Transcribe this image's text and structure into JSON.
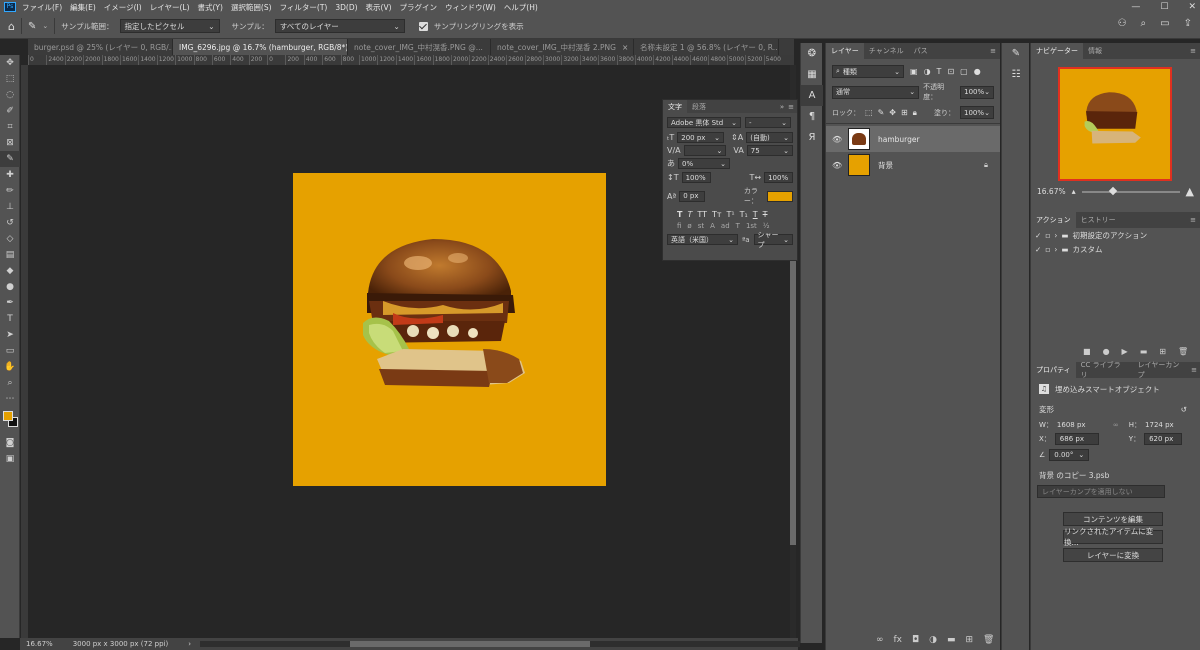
{
  "menu": [
    "ファイル(F)",
    "編集(E)",
    "イメージ(I)",
    "レイヤー(L)",
    "書式(Y)",
    "選択範囲(S)",
    "フィルター(T)",
    "3D(D)",
    "表示(V)",
    "プラグイン",
    "ウィンドウ(W)",
    "ヘルプ(H)"
  ],
  "app_logo": "Ps",
  "options": {
    "sample_area_label": "サンプル範囲：",
    "sample_area_value": "指定したピクセル",
    "sample_label": "サンプル：",
    "sample_value": "すべてのレイヤー",
    "show_ring_label": "サンプリングリングを表示"
  },
  "tabs": [
    {
      "title": "burger.psd @ 25% (レイヤー 0, RGB/...",
      "close": "×"
    },
    {
      "title": "IMG_6296.jpg @ 16.7% (hamburger, RGB/8*) *",
      "close": "×"
    },
    {
      "title": "note_cover_IMG_中村滉香.PNG @...",
      "close": "×"
    },
    {
      "title": "note_cover_IMG_中村滉香 2.PNG",
      "close": "×"
    },
    {
      "title": "名称未設定 1 @ 56.8% (レイヤー 0, R...",
      "close": "×"
    }
  ],
  "ruler": [
    "0",
    "2400",
    "2200",
    "2000",
    "1800",
    "1600",
    "1400",
    "1200",
    "1000",
    "800",
    "600",
    "400",
    "200",
    "0",
    "200",
    "400",
    "600",
    "800",
    "1000",
    "1200",
    "1400",
    "1600",
    "1800",
    "2000",
    "2200",
    "2400",
    "2600",
    "2800",
    "3000",
    "3200",
    "3400",
    "3600",
    "3800",
    "4000",
    "4200",
    "4400",
    "4600",
    "4800",
    "5000",
    "5200",
    "5400"
  ],
  "status": {
    "zoom": "16.67%",
    "size": "3000 px x 3000 px (72 ppi)"
  },
  "colors": {
    "canvas": "#e6a100",
    "panel": "#535353",
    "bg": "#262626",
    "accent": "#31a8ff"
  },
  "character": {
    "tabs": [
      "文字",
      "段落"
    ],
    "font_family": "Adobe 黒体 Std",
    "font_style": "-",
    "size": "200 px",
    "leading": "(自動)",
    "kerning": "",
    "tracking": "75",
    "tsume": "0%",
    "v_scale": "100%",
    "h_scale": "100%",
    "baseline": "0 px",
    "color_label": "カラー：",
    "language": "英語（米国）",
    "antialias": "シャープ",
    "style_buttons": [
      "T",
      "T",
      "TT",
      "Tт",
      "T¹",
      "T₁",
      "T",
      "T"
    ],
    "ot_buttons": [
      "fi",
      "ø",
      "st",
      "A",
      "ad",
      "T",
      "1st",
      "½"
    ]
  },
  "layers_panel": {
    "tabs": [
      "レイヤー",
      "チャンネル",
      "パス"
    ],
    "kind": "種類",
    "blend_mode": "通常",
    "opacity_label": "不透明度：",
    "opacity": "100%",
    "lock_label": "ロック：",
    "fill_label": "塗り：",
    "fill": "100%",
    "layers": [
      {
        "name": "hamburger",
        "selected": true
      },
      {
        "name": "背景",
        "selected": false
      }
    ]
  },
  "navigator": {
    "tabs": [
      "ナビゲーター",
      "情報"
    ],
    "zoom": "16.67%"
  },
  "actions": {
    "tabs": [
      "アクション",
      "ヒストリー"
    ],
    "items": [
      "初期設定のアクション",
      "カスタム"
    ]
  },
  "properties": {
    "tabs": [
      "プロパティ",
      "CC ライブラリ",
      "レイヤーカンプ"
    ],
    "type": "埋め込みスマートオブジェクト",
    "transform_label": "変形",
    "w_label": "W：",
    "w": "1608 px",
    "h_label": "H：",
    "h": "1724 px",
    "x_label": "X：",
    "x": "686 px",
    "y_label": "Y：",
    "y": "620 px",
    "angle": "0.00°",
    "file": "背景 のコピー 3.psb",
    "comp": "レイヤーカンプを適用しない",
    "buttons": [
      "コンテンツを編集",
      "リンクされたアイテムに変換...",
      "レイヤーに変換"
    ]
  }
}
